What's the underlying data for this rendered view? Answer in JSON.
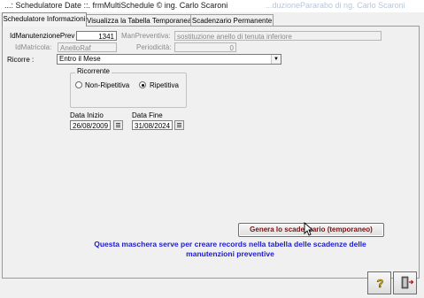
{
  "window": {
    "title": "...: Schedulatore Date ::.   frmMultiSchedule © ing. Carlo Scaroni",
    "ghost_text": "...duzionePararabo di ng. Carlo Scaroni"
  },
  "tabs": [
    {
      "label": "Schedulatore Informazioni",
      "active": true
    },
    {
      "label": "Visualizza la Tabella Temporanea",
      "active": false
    },
    {
      "label": "Scadenzario Permanente",
      "active": false
    }
  ],
  "form": {
    "id_manutenzione_label": "IdManutenzionePrev",
    "id_manutenzione_value": "1341",
    "man_preventiva_label": "ManPreventiva:",
    "man_preventiva_value": "sostituzione anello di tenuta inferiore",
    "id_matricola_label": "IdMatricola:",
    "id_matricola_value": "AnelloRaf",
    "periodicita_label": "Periodicità:",
    "periodicita_value": "0",
    "ricorre_label": "Ricorre :",
    "ricorre_value": "Entro il Mese",
    "ricorrente_group_title": "Ricorrente",
    "radio_non_ripetitiva": "Non-Ripetitiva",
    "radio_ripetitiva": "Ripetitiva",
    "selected_option": "Ripetitiva",
    "data_inizio_label": "Data Inizio",
    "data_inizio_value": "26/08/2009",
    "data_fine_label": "Data Fine",
    "data_fine_value": "31/08/2024"
  },
  "actions": {
    "generate_label": "Genera lo scadenzario (temporaneo)"
  },
  "info_message": {
    "line1": "Questa maschera serve per creare records nella tabella delle scadenze delle",
    "line2": "manutenzioni preventive"
  },
  "footer": {
    "help_icon": "help-icon",
    "exit_icon": "exit-door-icon"
  },
  "colors": {
    "info_text": "#1b1bd6",
    "generate_text": "#7a1010",
    "form_background": "#f0f0f0"
  }
}
